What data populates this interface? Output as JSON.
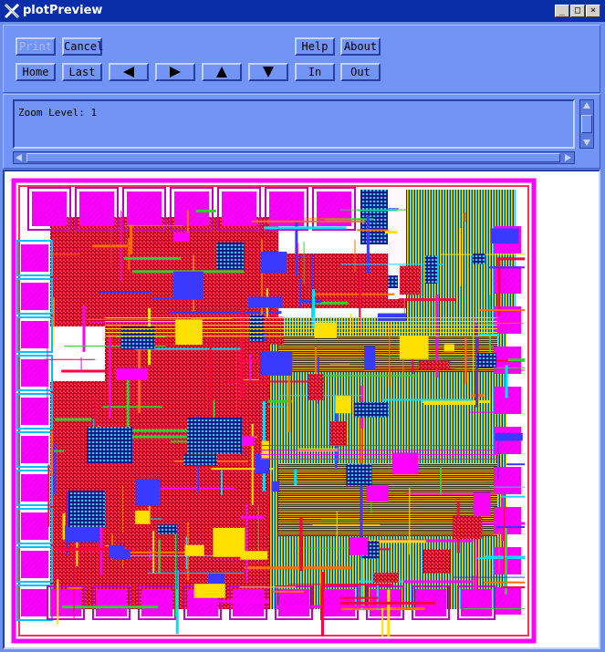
{
  "window": {
    "title": "plotPreview",
    "controls": {
      "minimize": "_",
      "maximize": "□",
      "close": "×"
    }
  },
  "toolbar": {
    "print_label": "Print",
    "cancel_label": "Cancel",
    "help_label": "Help",
    "about_label": "About",
    "home_label": "Home",
    "last_label": "Last",
    "in_label": "In",
    "out_label": "Out",
    "nav_icons": [
      "arrow-left-icon",
      "arrow-right-icon",
      "arrow-up-icon",
      "arrow-down-icon"
    ]
  },
  "status": {
    "zoom_text": "Zoom Level: 1"
  },
  "canvas": {
    "description_icon": "chip-layout-plot",
    "colors": {
      "magenta": "#ff00ff",
      "red": "#e8002a",
      "cyan": "#00e0ff",
      "yellow": "#ffe000",
      "blue": "#3a3aff",
      "green": "#30c030"
    }
  }
}
